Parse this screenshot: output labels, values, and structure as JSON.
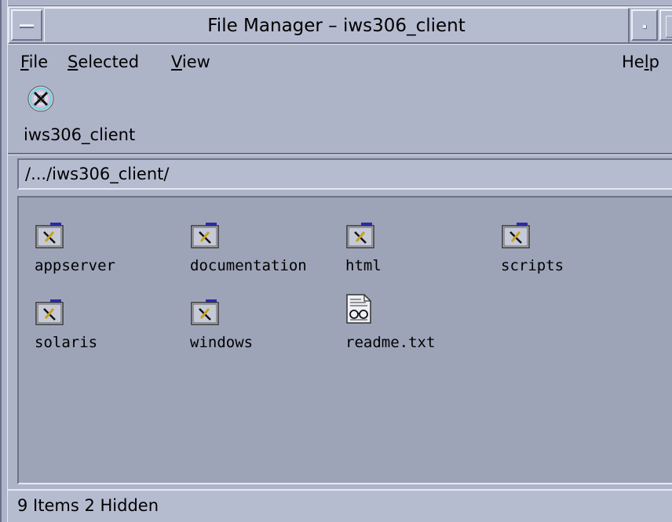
{
  "window": {
    "title": "File Manager – iws306_client"
  },
  "menubar": {
    "file": {
      "mnemonic": "F",
      "rest": "ile"
    },
    "selected": {
      "mnemonic": "S",
      "rest": "elected"
    },
    "view": {
      "mnemonic": "V",
      "rest": "iew"
    },
    "help": {
      "prefix": "He",
      "mnemonic": "l",
      "rest": "p"
    }
  },
  "toolbar": {
    "icon": "cd-rom-icon",
    "host_label": "iws306_client"
  },
  "path": {
    "value": "/.../iws306_client/"
  },
  "files": [
    {
      "name": "appserver",
      "type": "folder"
    },
    {
      "name": "documentation",
      "type": "folder"
    },
    {
      "name": "html",
      "type": "folder"
    },
    {
      "name": "scripts",
      "type": "folder"
    },
    {
      "name": "solaris",
      "type": "folder"
    },
    {
      "name": "windows",
      "type": "folder"
    },
    {
      "name": "readme.txt",
      "type": "text-file"
    }
  ],
  "status": {
    "text": "9 Items 2 Hidden"
  },
  "colors": {
    "window_bg": "#aeb4c8",
    "pane_bg": "#9ea4b8",
    "folder_blue": "#2a2ab0"
  }
}
